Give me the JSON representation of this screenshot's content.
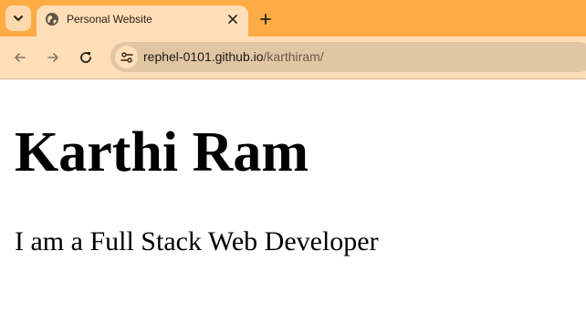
{
  "browser": {
    "tab": {
      "title": "Personal Website",
      "favicon": "globe-icon"
    },
    "toolbar": {
      "url_host": "rephel-0101.github.io",
      "url_path": "/karthiram/"
    },
    "colors": {
      "tabstrip": "#ffab45",
      "active_tab": "#ffdeb8",
      "omnibox": "#e1c6a4"
    }
  },
  "page": {
    "title": "Karthi Ram",
    "subtitle": "I am a Full Stack Web Developer"
  }
}
